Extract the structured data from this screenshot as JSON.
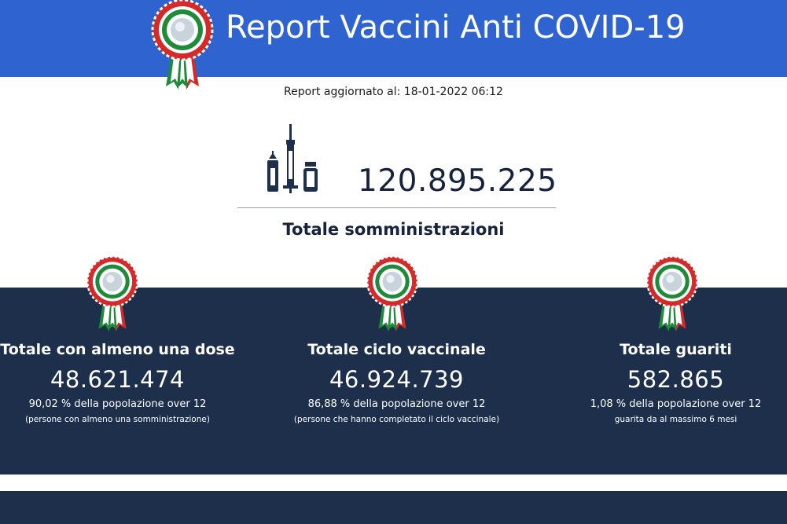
{
  "header": {
    "title": "Report Vaccini Anti COVID-19",
    "logo_icon": "italian-cockade-icon"
  },
  "report": {
    "updated_label": "Report aggiornato al: 18-01-2022 06:12"
  },
  "hero": {
    "icon": "vaccine-syringe-vials-icon",
    "value": "120.895.225",
    "label": "Totale somministrazioni"
  },
  "stats": [
    {
      "title": "Totale con almeno una dose",
      "value": "48.621.474",
      "percent": "90,02 % della popolazione over 12",
      "note": "(persone con almeno una somministrazione)"
    },
    {
      "title": "Totale ciclo vaccinale",
      "value": "46.924.739",
      "percent": "86,88 % della popolazione over 12",
      "note": "(persone che hanno completato il ciclo vaccinale)"
    },
    {
      "title": "Totale guariti",
      "value": "582.865",
      "percent": "1,08 % della popolazione over 12",
      "note": "guarita da al massimo 6 mesi"
    }
  ],
  "colors": {
    "header_bg": "#2f63cf",
    "band_bg": "#1d2f4b",
    "text_dark": "#17233a",
    "cockade_red": "#d42a2a",
    "cockade_green": "#1f8a3a"
  }
}
